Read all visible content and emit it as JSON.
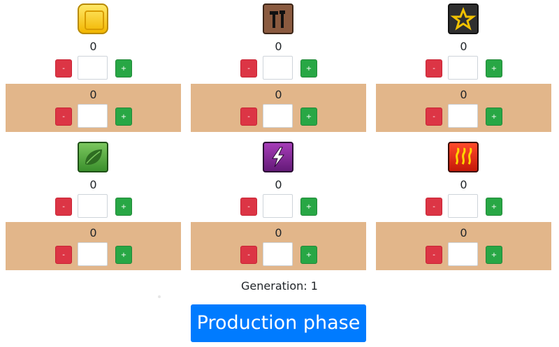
{
  "resources": [
    {
      "name": "megacredits",
      "icon": "megacredit-icon",
      "production": "0",
      "stock": "0",
      "minus": "-",
      "plus": "+"
    },
    {
      "name": "steel",
      "icon": "steel-tools-icon",
      "production": "0",
      "stock": "0",
      "minus": "-",
      "plus": "+"
    },
    {
      "name": "titanium",
      "icon": "titanium-star-icon",
      "production": "0",
      "stock": "0",
      "minus": "-",
      "plus": "+"
    },
    {
      "name": "plants",
      "icon": "leaf-icon",
      "production": "0",
      "stock": "0",
      "minus": "-",
      "plus": "+"
    },
    {
      "name": "energy",
      "icon": "lightning-icon",
      "production": "0",
      "stock": "0",
      "minus": "-",
      "plus": "+"
    },
    {
      "name": "heat",
      "icon": "heat-waves-icon",
      "production": "0",
      "stock": "0",
      "minus": "-",
      "plus": "+"
    }
  ],
  "generation_label": "Generation: 1",
  "phase_button": "Production phase",
  "colors": {
    "stock_bg": "#e2b68a",
    "minus": "#dc3545",
    "plus": "#28a745",
    "primary": "#007bff"
  }
}
